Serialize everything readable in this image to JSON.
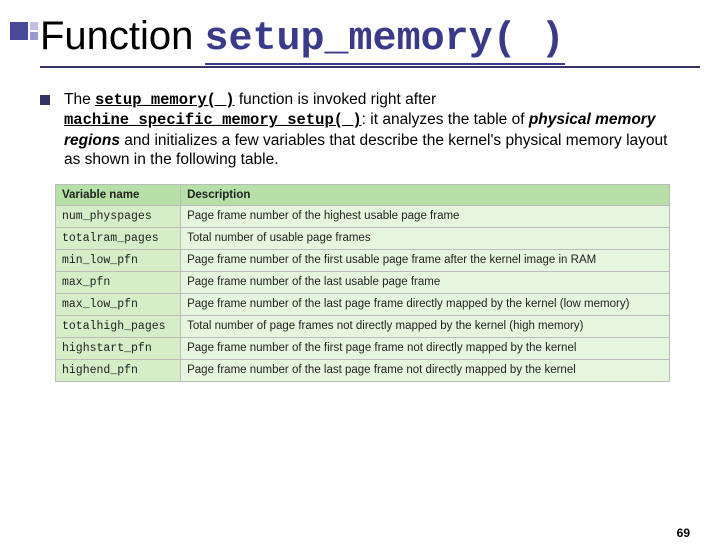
{
  "decor": {
    "present": true
  },
  "title": {
    "prefix": "Function ",
    "code": "setup_memory( )"
  },
  "paragraph": {
    "t1": "The ",
    "c1": "setup_memory( )",
    "t2": " function is invoked right after ",
    "c2": "machine_specific_memory_setup( )",
    "t3": ": it analyzes the table of ",
    "i1": "physical memory regions",
    "t4": " and initializes a few variables that describe the kernel's physical memory layout as shown in the following table."
  },
  "table": {
    "headers": [
      "Variable name",
      "Description"
    ],
    "rows": [
      [
        "num_physpages",
        "Page frame number of the highest usable page frame"
      ],
      [
        "totalram_pages",
        "Total number of usable page frames"
      ],
      [
        "min_low_pfn",
        "Page frame number of the first usable page frame after the kernel image in RAM"
      ],
      [
        "max_pfn",
        "Page frame number of the last usable page frame"
      ],
      [
        "max_low_pfn",
        "Page frame number of the last page frame directly mapped by the kernel (low memory)"
      ],
      [
        "totalhigh_pages",
        "Total number of page frames not directly mapped by the kernel (high memory)"
      ],
      [
        "highstart_pfn",
        "Page frame number of the first page frame not directly mapped by the kernel"
      ],
      [
        "highend_pfn",
        "Page frame number of the last page frame not directly mapped by the kernel"
      ]
    ]
  },
  "page_number": "69"
}
